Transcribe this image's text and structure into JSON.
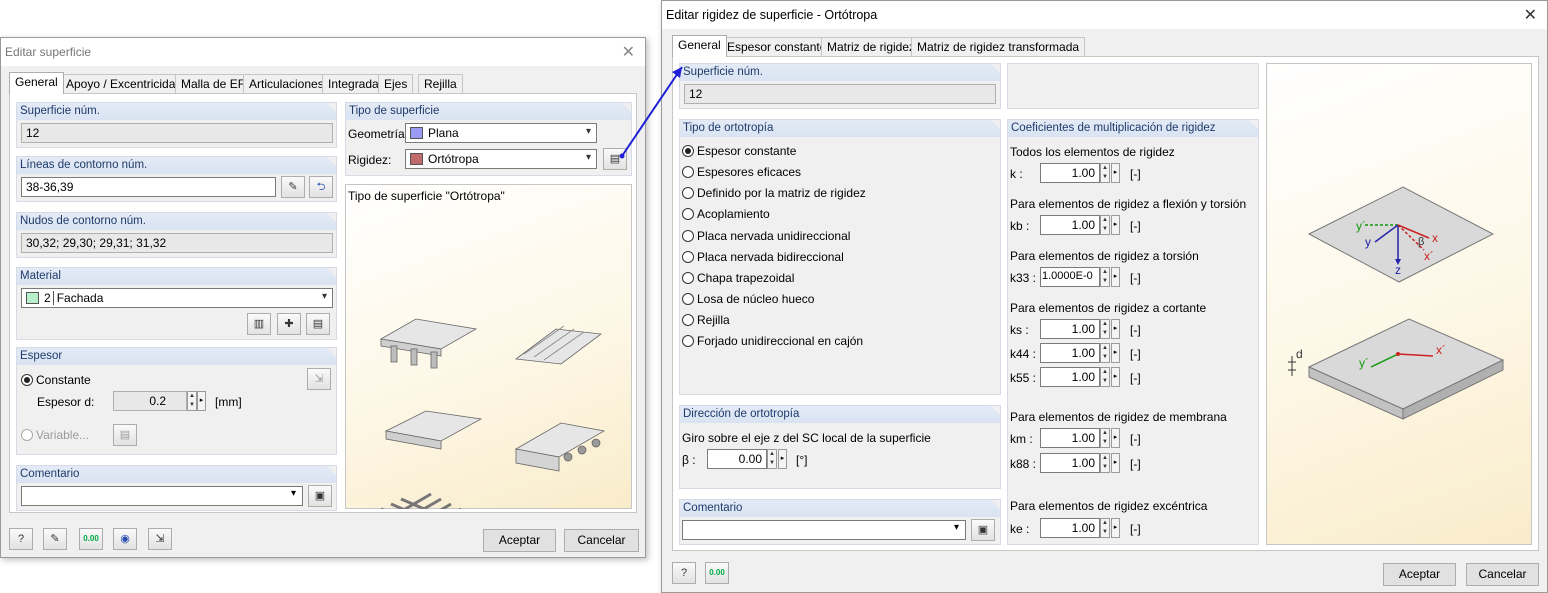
{
  "left_dialog": {
    "title": "Editar superficie",
    "tabs": [
      "General",
      "Apoyo / Excentricidad",
      "Malla de EF",
      "Articulaciones",
      "Integrada",
      "Ejes",
      "Rejilla"
    ],
    "surface_no": {
      "label": "Superficie núm.",
      "value": "12"
    },
    "boundary_lines": {
      "label": "Líneas de contorno núm.",
      "value": "38-36,39"
    },
    "boundary_nodes": {
      "label": "Nudos de contorno núm.",
      "value": "30,32; 29,30; 29,31; 31,32"
    },
    "material": {
      "label": "Material",
      "number": "2",
      "name": "Fachada",
      "color": "#b9f0cc"
    },
    "thickness": {
      "label": "Espesor",
      "constant": "Constante",
      "thickness_label": "Espesor d:",
      "value": "0.2",
      "unit": "[mm]",
      "variable": "Variable..."
    },
    "comment": {
      "label": "Comentario",
      "value": ""
    },
    "surface_type": {
      "label": "Tipo de superficie",
      "geometry_label": "Geometría:",
      "geometry_value": "Plana",
      "geometry_color": "#9b9bf5",
      "stiffness_label": "Rigidez:",
      "stiffness_value": "Ortótropa",
      "stiffness_color": "#c06a6a"
    },
    "preview_title": "Tipo de superficie \"Ortótropa\"",
    "buttons": {
      "ok": "Aceptar",
      "cancel": "Cancelar"
    },
    "toolbar_icons": [
      "help-icon",
      "edit-icon",
      "units-icon",
      "view-icon",
      "pick-icon"
    ],
    "units_icon_text": "0.00"
  },
  "right_dialog": {
    "title": "Editar rigidez de superficie - Ortótropa",
    "tabs": [
      "General",
      "Espesor constante",
      "Matriz de rigidez",
      "Matriz de rigidez transformada"
    ],
    "surface_no": {
      "label": "Superficie núm.",
      "value": "12"
    },
    "ortho_type": {
      "label": "Tipo de ortotropía",
      "options": [
        "Espesor constante",
        "Espesores eficaces",
        "Definido por la matriz de rigidez",
        "Acoplamiento",
        "Placa nervada unidireccional",
        "Placa nervada bidireccional",
        "Chapa trapezoidal",
        "Losa de núcleo hueco",
        "Rejilla",
        "Forjado unidireccional en cajón"
      ],
      "selected": 0
    },
    "direction": {
      "label": "Dirección de ortotropía",
      "text": "Giro sobre el eje z del SC local de la superficie",
      "beta_label": "β :",
      "beta_value": "0.00",
      "unit": "[°]"
    },
    "comment": {
      "label": "Comentario",
      "value": ""
    },
    "coefficients": {
      "label": "Coeficientes de multiplicación de rigidez",
      "groups": [
        {
          "title": "Todos los elementos de rigidez",
          "rows": [
            {
              "sym": "k :",
              "value": "1.00",
              "unit": "[-]"
            }
          ]
        },
        {
          "title": "Para elementos de rigidez a flexión y torsión",
          "rows": [
            {
              "sym": "kb :",
              "value": "1.00",
              "unit": "[-]"
            }
          ]
        },
        {
          "title": "Para elementos de rigidez a torsión",
          "rows": [
            {
              "sym": "k33 :",
              "value": "1.0000E-0",
              "unit": "[-]"
            }
          ]
        },
        {
          "title": "Para elementos de rigidez a cortante",
          "rows": [
            {
              "sym": "ks :",
              "value": "1.00",
              "unit": "[-]"
            },
            {
              "sym": "k44 :",
              "value": "1.00",
              "unit": "[-]"
            },
            {
              "sym": "k55 :",
              "value": "1.00",
              "unit": "[-]"
            }
          ]
        },
        {
          "title": "Para elementos de rigidez de membrana",
          "rows": [
            {
              "sym": "km :",
              "value": "1.00",
              "unit": "[-]"
            },
            {
              "sym": "k88 :",
              "value": "1.00",
              "unit": "[-]"
            }
          ]
        },
        {
          "title": "Para elementos de rigidez excéntrica",
          "rows": [
            {
              "sym": "ke :",
              "value": "1.00",
              "unit": "[-]"
            }
          ]
        }
      ]
    },
    "diagram": {
      "labels": {
        "y_prime": "y´",
        "y": "y",
        "beta": "β",
        "x": "x",
        "x_prime": "x´",
        "z": "z",
        "d": "d",
        "y_prime2": "y´",
        "x_prime2": "x´"
      }
    },
    "buttons": {
      "ok": "Aceptar",
      "cancel": "Cancelar"
    },
    "units_icon_text": "0.00"
  }
}
